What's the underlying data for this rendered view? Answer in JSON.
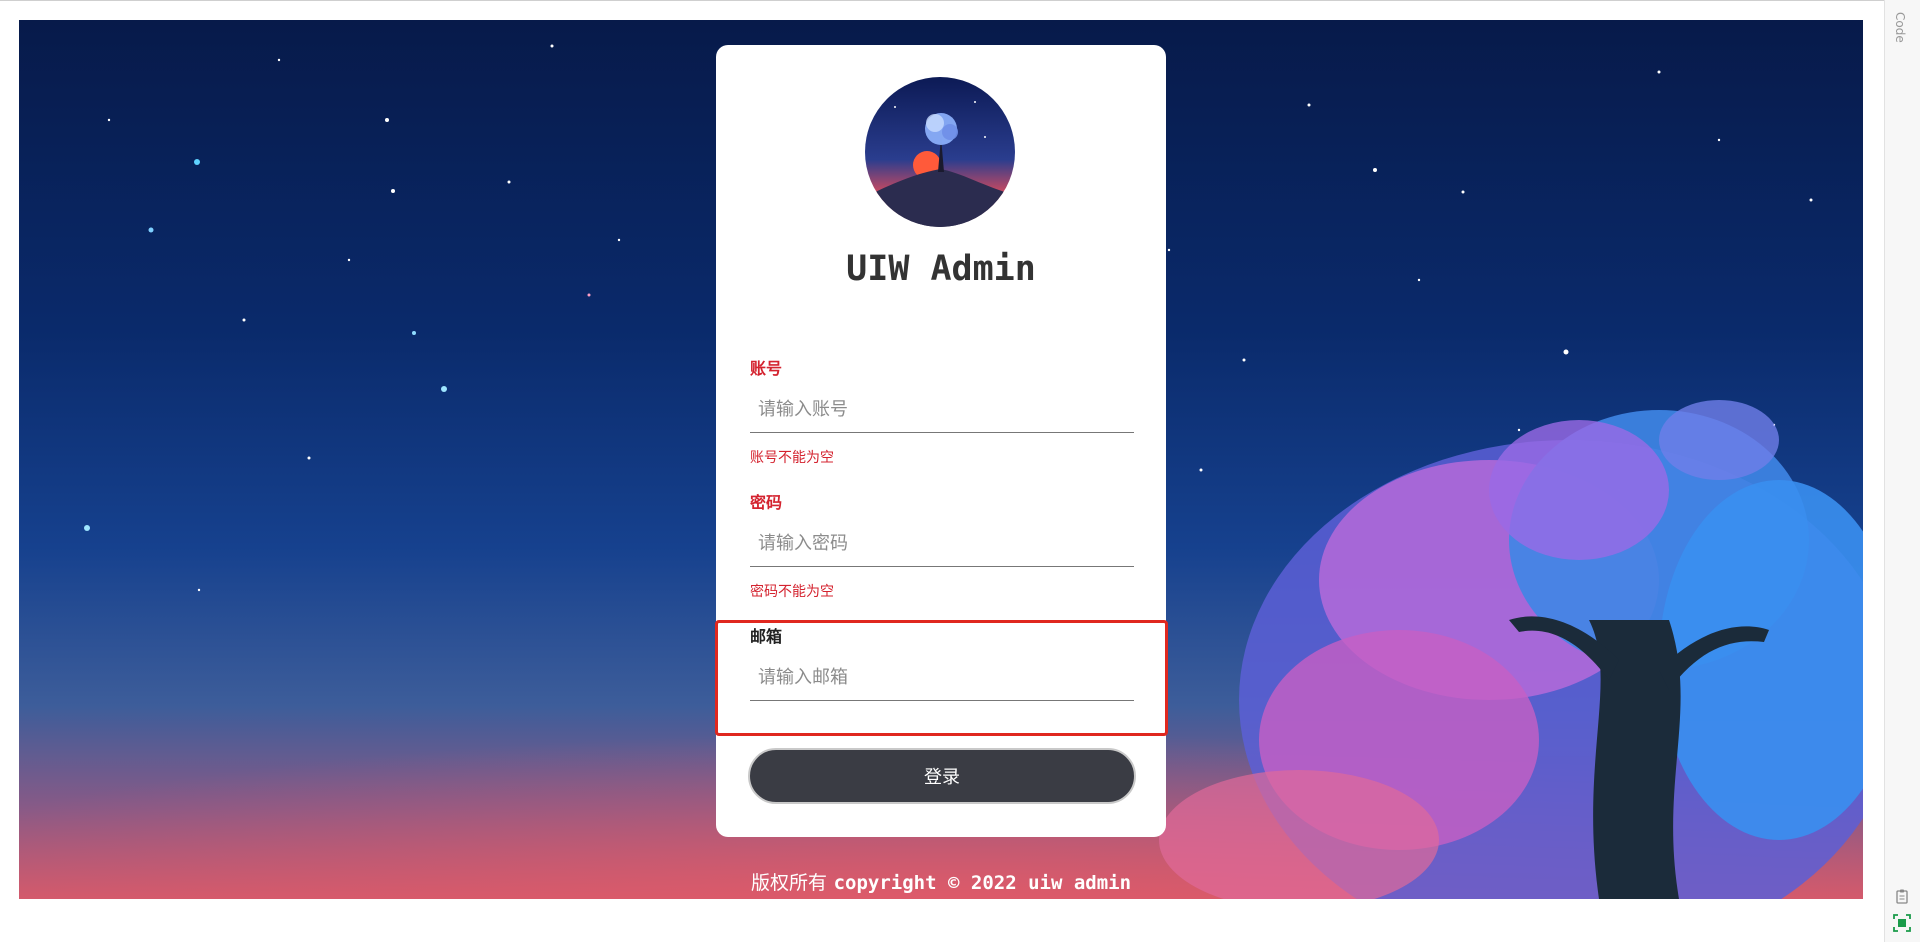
{
  "app": {
    "title": "UIW Admin"
  },
  "form": {
    "account": {
      "label": "账号",
      "placeholder": "请输入账号",
      "value": "",
      "error": "账号不能为空"
    },
    "password": {
      "label": "密码",
      "placeholder": "请输入密码",
      "value": "",
      "error": "密码不能为空"
    },
    "email": {
      "label": "邮箱",
      "placeholder": "请输入邮箱",
      "value": ""
    },
    "submit_label": "登录"
  },
  "footer": {
    "prefix": "版权所有",
    "text": "copyright © 2022 uiw admin"
  },
  "side_panel": {
    "code_label": "Code"
  },
  "colors": {
    "error": "#d4232f",
    "button_bg": "#3a3c44",
    "highlight": "#e0281f"
  },
  "icons": [
    "clipboard-icon",
    "screenshot-icon"
  ]
}
